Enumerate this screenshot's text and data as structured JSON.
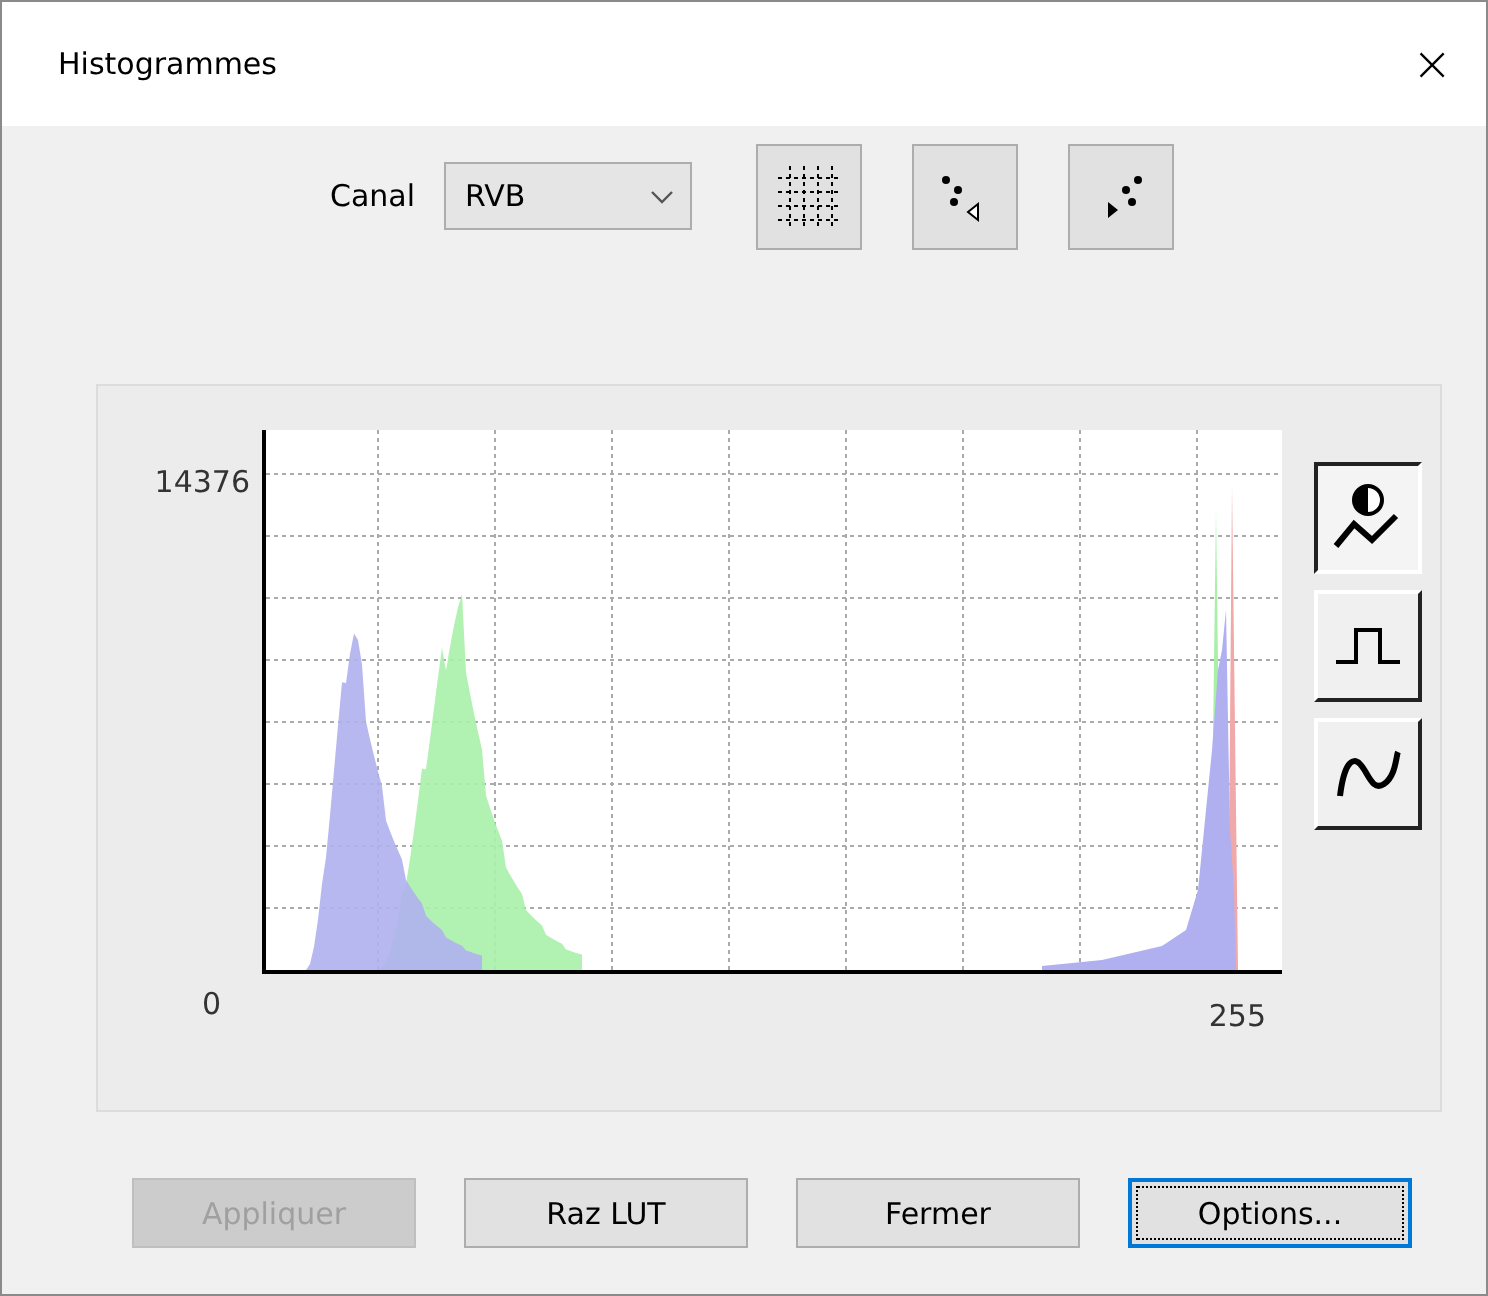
{
  "window": {
    "title": "Histogrammes",
    "close": "×"
  },
  "toolbar": {
    "label": "Canal",
    "channel": "RVB"
  },
  "histogram": {
    "y_max": "14376",
    "y_min": "0",
    "x_max": "255"
  },
  "modes": [
    {
      "kind": "levels",
      "selected": true
    },
    {
      "kind": "step",
      "selected": false
    },
    {
      "kind": "curve",
      "selected": false
    }
  ],
  "buttons": [
    {
      "label": "Appliquer",
      "disabled": true,
      "focused": false
    },
    {
      "label": "Raz LUT",
      "disabled": false,
      "focused": false
    },
    {
      "label": "Fermer",
      "disabled": false,
      "focused": false
    },
    {
      "label": "Options...",
      "disabled": false,
      "focused": true
    }
  ]
}
